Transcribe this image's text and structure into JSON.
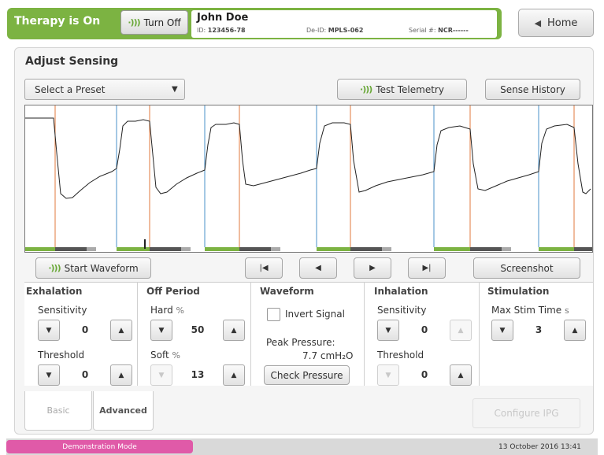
{
  "header": {
    "therapy_status": "Therapy is On",
    "turn_off_label": "Turn Off",
    "patient_name": "John Doe",
    "id_label": "ID:",
    "id_value": "123456-78",
    "deid_label": "De-ID:",
    "deid_value": "MPLS-062",
    "serial_label": "Serial #:",
    "serial_value": "NCR------",
    "home_label": "Home"
  },
  "page": {
    "title": "Adjust Sensing",
    "preset_placeholder": "Select a Preset",
    "test_telemetry_label": "Test Telemetry",
    "sense_history_label": "Sense History"
  },
  "waveform_controls": {
    "start_label": "Start Waveform",
    "screenshot_label": "Screenshot"
  },
  "sections": {
    "exhalation": {
      "title": "Exhalation",
      "sensitivity_label": "Sensitivity",
      "sensitivity_value": "0",
      "threshold_label": "Threshold",
      "threshold_value": "0"
    },
    "off_period": {
      "title": "Off Period",
      "hard_label": "Hard",
      "hard_unit": "%",
      "hard_value": "50",
      "soft_label": "Soft",
      "soft_unit": "%",
      "soft_value": "13"
    },
    "waveform": {
      "title": "Waveform",
      "invert_label": "Invert Signal",
      "peak_label": "Peak Pressure:",
      "peak_value": "7.7 cmH₂O",
      "check_label": "Check Pressure"
    },
    "inhalation": {
      "title": "Inhalation",
      "sensitivity_label": "Sensitivity",
      "sensitivity_value": "0",
      "threshold_label": "Threshold",
      "threshold_value": "0"
    },
    "stimulation": {
      "title": "Stimulation",
      "max_stim_label": "Max Stim Time",
      "max_stim_unit": "s",
      "max_stim_value": "3"
    }
  },
  "tabs": {
    "basic": "Basic",
    "advanced": "Advanced"
  },
  "configure_ipg_label": "Configure IPG",
  "footer": {
    "mode": "Demonstration Mode",
    "datetime": "13 October 2016 13:41"
  },
  "colors": {
    "brand_green": "#7cb342",
    "inhale_marker": "#e07a3c",
    "exhale_marker": "#4a90c8",
    "demo_pink": "#e05aa8"
  }
}
